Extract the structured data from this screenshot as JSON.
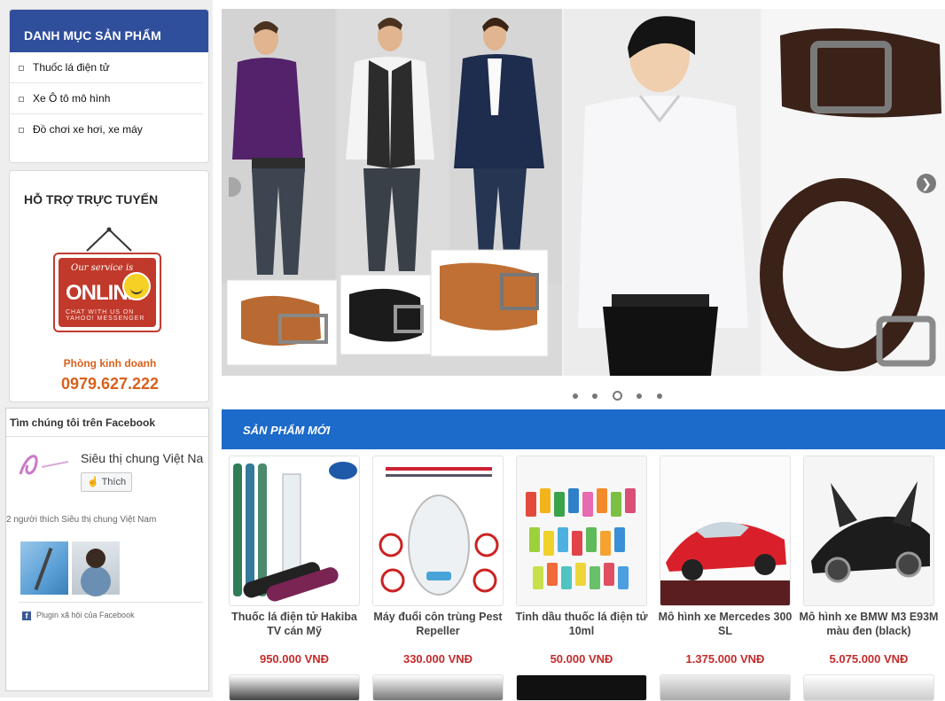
{
  "sidebar": {
    "categories_title": "DANH MỤC SẢN PHẨM",
    "categories": [
      {
        "label": "Thuốc lá điện tử"
      },
      {
        "label": "Xe Ô tô mô hình"
      },
      {
        "label": "Đồ chơi xe hơi, xe máy"
      }
    ],
    "support": {
      "title": "HỖ TRỢ TRỰC TUYẾN",
      "sign_script": "Our service is",
      "sign_word": "ONLINE",
      "sign_sub": "CHAT WITH US ON YAHOO! MESSENGER",
      "department": "Phòng kinh doanh",
      "hotline": "0979.627.222"
    },
    "facebook": {
      "title": "Tìm chúng tôi trên Facebook",
      "page_name": "Siêu thị chung Việt Na",
      "like_label": "Thích",
      "like_count_text": "2 người thích Siêu thị chung Việt Nam",
      "plugin_text": "Plugin xã hội của Facebook"
    }
  },
  "new_products": {
    "title": "SẢN PHẨM MỚI",
    "items": [
      {
        "name": "Thuốc lá điện tử Hakiba TV cán Mỹ",
        "price": "950.000 VNĐ"
      },
      {
        "name": "Máy đuổi côn trùng Pest Repeller",
        "price": "330.000 VNĐ"
      },
      {
        "name": "Tinh dầu thuốc lá điện tử 10ml",
        "price": "50.000 VNĐ"
      },
      {
        "name": "Mô hình xe Mercedes 300 SL",
        "price": "1.375.000 VNĐ"
      },
      {
        "name": "Mô hình xe BMW M3 E93M màu đen (black)",
        "price": "5.075.000 VNĐ"
      }
    ]
  },
  "banner": {
    "slides": 5,
    "active_slide": 3
  },
  "colors": {
    "primary_blue": "#1c6ac9",
    "category_header": "#2f4e9c",
    "price_red": "#c42b2b",
    "hotline_orange": "#d9601b"
  }
}
